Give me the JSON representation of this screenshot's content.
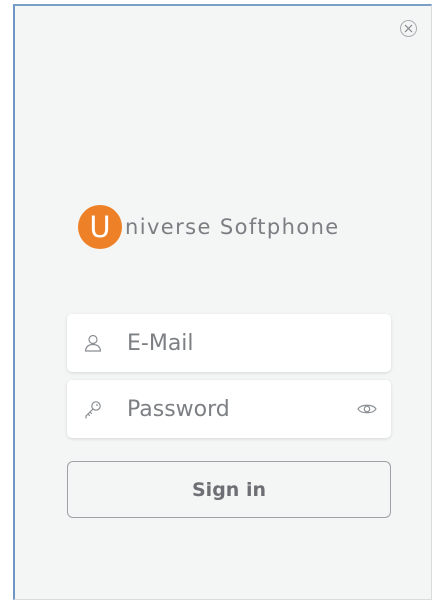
{
  "app": {
    "brand_initial": "U",
    "brand_rest": "niverse Softphone",
    "brand_color": "#ee8127"
  },
  "form": {
    "email": {
      "placeholder": "E-Mail",
      "value": "",
      "icon": "user-icon"
    },
    "password": {
      "placeholder": "Password",
      "value": "",
      "icon": "key-icon",
      "toggle_icon": "eye-icon"
    },
    "signin_label": "Sign in"
  },
  "window": {
    "close_icon": "close-icon"
  }
}
